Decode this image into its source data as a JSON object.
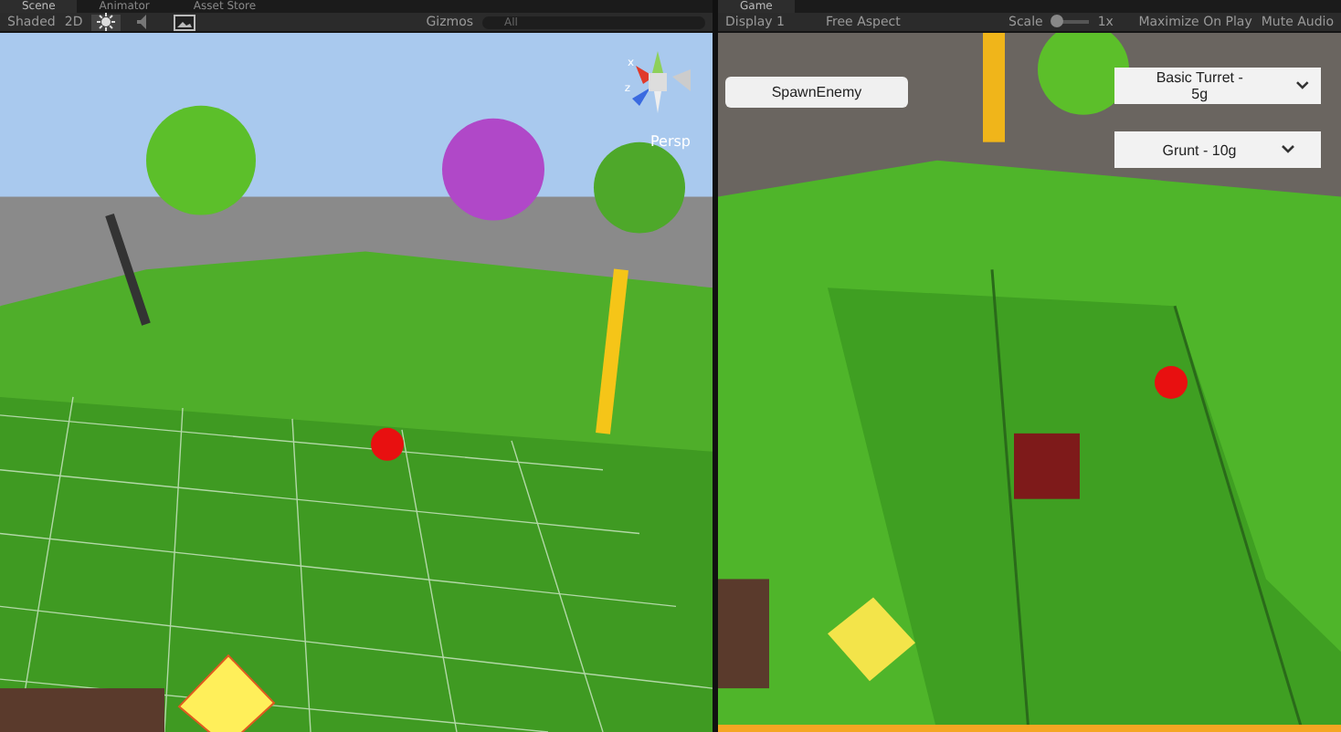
{
  "scene_tabs": [
    {
      "label": "Scene",
      "selected": true
    },
    {
      "label": "Animator",
      "selected": false
    },
    {
      "label": "Asset Store",
      "selected": false
    }
  ],
  "game_tab": {
    "label": "Game",
    "selected": true
  },
  "scene_toolbar": {
    "shading": "Shaded",
    "mode_2d": "2D",
    "lighting_on": true,
    "gizmos": "Gizmos",
    "search": {
      "placeholder": "All"
    }
  },
  "scene_view": {
    "projection": "Persp",
    "axis_labels": [
      "x",
      "z"
    ]
  },
  "game_toolbar": {
    "display": "Display 1",
    "aspect": "Free Aspect",
    "scale_label": "Scale",
    "scale": {
      "level": 0.1,
      "reading": "1x"
    },
    "maximize": "Maximize On Play",
    "mute": "Mute Audio"
  },
  "game_view": {
    "spawn_button": "SpawnEnemy",
    "dropdowns": [
      "Basic Turret - 5g",
      "Grunt - 10g"
    ]
  }
}
